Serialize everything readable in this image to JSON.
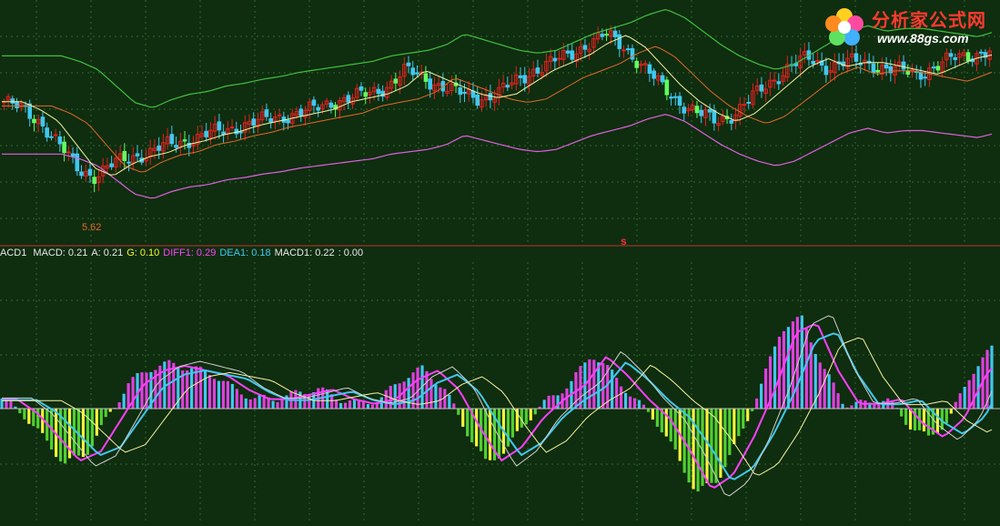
{
  "logo": {
    "title": "分析家公式网",
    "url": "www.88gs.com"
  },
  "price_panel": {
    "low_label": "5.62",
    "signal_mark": "s"
  },
  "indicator": {
    "name": "ACD1",
    "items": [
      {
        "label": "MACD:",
        "value": "0.21",
        "color": "#e8e8e8"
      },
      {
        "label": "A:",
        "value": "0.21",
        "color": "#e8e8e8"
      },
      {
        "label": "G:",
        "value": "0.10",
        "color": "#f5f53a"
      },
      {
        "label": "DIFF1:",
        "value": "0.29",
        "color": "#ff40ff"
      },
      {
        "label": "DEA1:",
        "value": "0.18",
        "color": "#40c8f0"
      },
      {
        "label": "MACD1:",
        "value": "0.22",
        "color": "#e8e8e8"
      },
      {
        "label": "",
        "value": ": 0.00",
        "color": "#e8e8e8"
      }
    ]
  },
  "colors": {
    "background": "#0f2d0f",
    "grid": "#2d6a2d",
    "candle_up": "#e02020",
    "candle_down": "#40c8f0",
    "candle_other": "#60ff60",
    "band_upper": "#40c040",
    "band_lower": "#e060e0",
    "ma_orange": "#e06a2a",
    "diff": "#ff40ff",
    "dea": "#40c8f0",
    "yellow_line": "#f5f5a0"
  },
  "chart_data": {
    "type": "candlestick+macd",
    "price_series": {
      "close_shape": [
        0.62,
        0.58,
        0.52,
        0.4,
        0.28,
        0.24,
        0.3,
        0.34,
        0.36,
        0.4,
        0.42,
        0.45,
        0.47,
        0.5,
        0.52,
        0.54,
        0.56,
        0.58,
        0.62,
        0.64,
        0.66,
        0.7,
        0.78,
        0.74,
        0.7,
        0.66,
        0.64,
        0.66,
        0.72,
        0.78,
        0.82,
        0.86,
        0.92,
        0.96,
        0.9,
        0.8,
        0.7,
        0.62,
        0.56,
        0.52,
        0.56,
        0.64,
        0.72,
        0.8,
        0.84,
        0.8,
        0.82,
        0.82,
        0.8,
        0.78,
        0.76,
        0.8,
        0.84,
        0.86,
        0.88
      ]
    },
    "macd_series": {
      "hist_shape": [
        0.1,
        -0.05,
        -0.3,
        -0.55,
        -0.45,
        -0.1,
        0.25,
        0.4,
        0.45,
        0.4,
        0.35,
        0.2,
        0.1,
        0.1,
        0.15,
        0.2,
        0.1,
        0.05,
        0.1,
        0.3,
        0.4,
        0.2,
        -0.2,
        -0.55,
        -0.4,
        -0.1,
        0.1,
        0.25,
        0.55,
        0.35,
        0.1,
        -0.1,
        -0.45,
        -0.85,
        -0.7,
        -0.3,
        0.2,
        0.8,
        0.9,
        0.4,
        0.05,
        0.05,
        0.1,
        -0.15,
        -0.3,
        -0.1,
        0.35,
        0.6
      ]
    }
  }
}
